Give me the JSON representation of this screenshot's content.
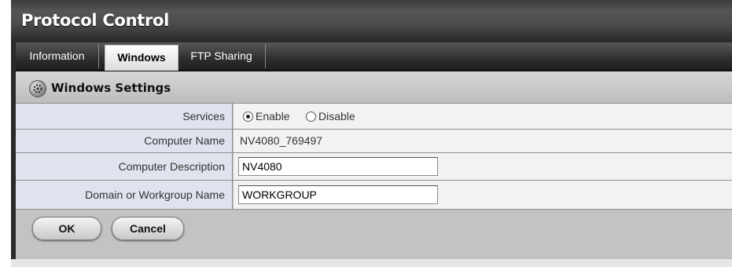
{
  "app": {
    "title": "Protocol Control"
  },
  "tabs": [
    {
      "label": "Information",
      "active": false
    },
    {
      "label": "Windows",
      "active": true
    },
    {
      "label": "FTP Sharing",
      "active": false
    }
  ],
  "section": {
    "title": "Windows Settings",
    "icon": "gear-icon"
  },
  "form": {
    "services": {
      "label": "Services",
      "options": [
        "Enable",
        "Disable"
      ],
      "selected": "Enable"
    },
    "computer_name": {
      "label": "Computer Name",
      "value": "NV4080_769497"
    },
    "computer_description": {
      "label": "Computer Description",
      "value": "NV4080"
    },
    "domain": {
      "label": "Domain or Workgroup Name",
      "value": "WORKGROUP"
    }
  },
  "buttons": {
    "ok": "OK",
    "cancel": "Cancel"
  }
}
